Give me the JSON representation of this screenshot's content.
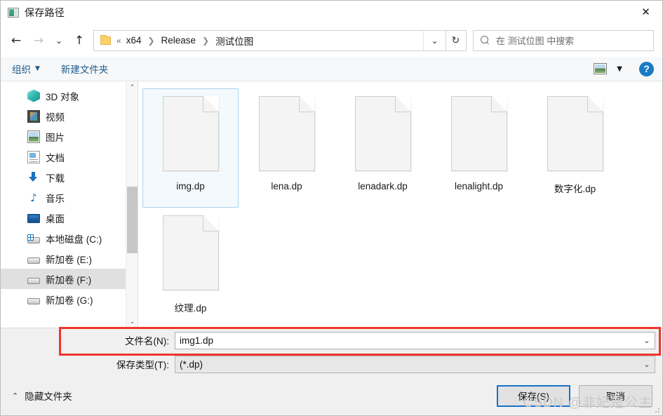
{
  "window": {
    "title": "保存路径",
    "icon": "picture-icon",
    "close_label": "✕"
  },
  "nav": {
    "back": "←",
    "forward": "→",
    "recent": "⌄",
    "up": "↑",
    "address": {
      "folder_icon": "folder-icon",
      "ellipsis": "«",
      "crumbs": [
        "x64",
        "Release",
        "测试位图"
      ],
      "separator": "❯",
      "dropdown": "⌄"
    },
    "refresh": "↻",
    "search": {
      "placeholder": "在 测试位图 中搜索",
      "icon": "search-icon"
    }
  },
  "toolbar": {
    "organize": "组织",
    "organize_caret": "▼",
    "new_folder": "新建文件夹",
    "view_icon": "picture-view-icon",
    "view_caret": "▼",
    "help": "?"
  },
  "sidebar": {
    "items": [
      {
        "label": "3D 对象",
        "icon": "cube-icon",
        "selected": false
      },
      {
        "label": "视频",
        "icon": "video-icon",
        "selected": false
      },
      {
        "label": "图片",
        "icon": "picture-icon",
        "selected": false
      },
      {
        "label": "文档",
        "icon": "document-icon",
        "selected": false
      },
      {
        "label": "下载",
        "icon": "download-icon",
        "selected": false
      },
      {
        "label": "音乐",
        "icon": "music-icon",
        "selected": false
      },
      {
        "label": "桌面",
        "icon": "desktop-icon",
        "selected": false
      },
      {
        "label": "本地磁盘 (C:)",
        "icon": "drive-system-icon",
        "selected": false
      },
      {
        "label": "新加卷 (E:)",
        "icon": "drive-icon",
        "selected": false
      },
      {
        "label": "新加卷 (F:)",
        "icon": "drive-icon",
        "selected": true
      },
      {
        "label": "新加卷 (G:)",
        "icon": "drive-icon",
        "selected": false
      }
    ],
    "scroll_up": "⌃",
    "scroll_down": "⌄"
  },
  "files": [
    {
      "name": "img.dp",
      "selected": true
    },
    {
      "name": "lena.dp",
      "selected": false
    },
    {
      "name": "lenadark.dp",
      "selected": false
    },
    {
      "name": "lenalight.dp",
      "selected": false
    },
    {
      "name": "数字化.dp",
      "selected": false
    },
    {
      "name": "纹理.dp",
      "selected": false
    }
  ],
  "form": {
    "filename_label": "文件名(N):",
    "filename_value": "img1.dp",
    "filetype_label": "保存类型(T):",
    "filetype_value": "(*.dp)",
    "caret": "⌄",
    "highlight_color": "#f2342f"
  },
  "footer": {
    "hide_folders": "隐藏文件夹",
    "chevron": "⌃",
    "save": "保存(S)",
    "cancel": "取消",
    "watermark": "CSDN @非妃是公主",
    "accent_color": "#1673c9"
  }
}
